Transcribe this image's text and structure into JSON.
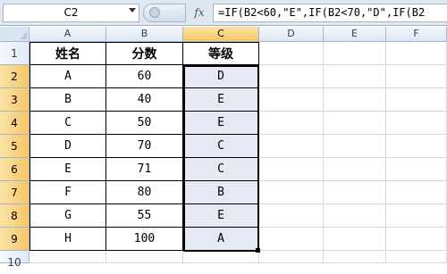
{
  "name_box": "C2",
  "formula": "=IF(B2<60,\"E\",IF(B2<70,\"D\",IF(B2",
  "fx_label": "fx",
  "columns": [
    "A",
    "B",
    "C",
    "D",
    "E",
    "F"
  ],
  "rows": [
    "1",
    "2",
    "3",
    "4",
    "5",
    "6",
    "7",
    "8",
    "9",
    "10"
  ],
  "table": {
    "headers": [
      "姓名",
      "分数",
      "等级"
    ],
    "data": [
      [
        "A",
        "60",
        "D"
      ],
      [
        "B",
        "40",
        "E"
      ],
      [
        "C",
        "50",
        "E"
      ],
      [
        "D",
        "70",
        "C"
      ],
      [
        "E",
        "71",
        "C"
      ],
      [
        "F",
        "80",
        "B"
      ],
      [
        "G",
        "55",
        "E"
      ],
      [
        "H",
        "100",
        "A"
      ]
    ]
  },
  "active_cell": "C2",
  "active_column": "C",
  "selection_range": "C2:C9"
}
